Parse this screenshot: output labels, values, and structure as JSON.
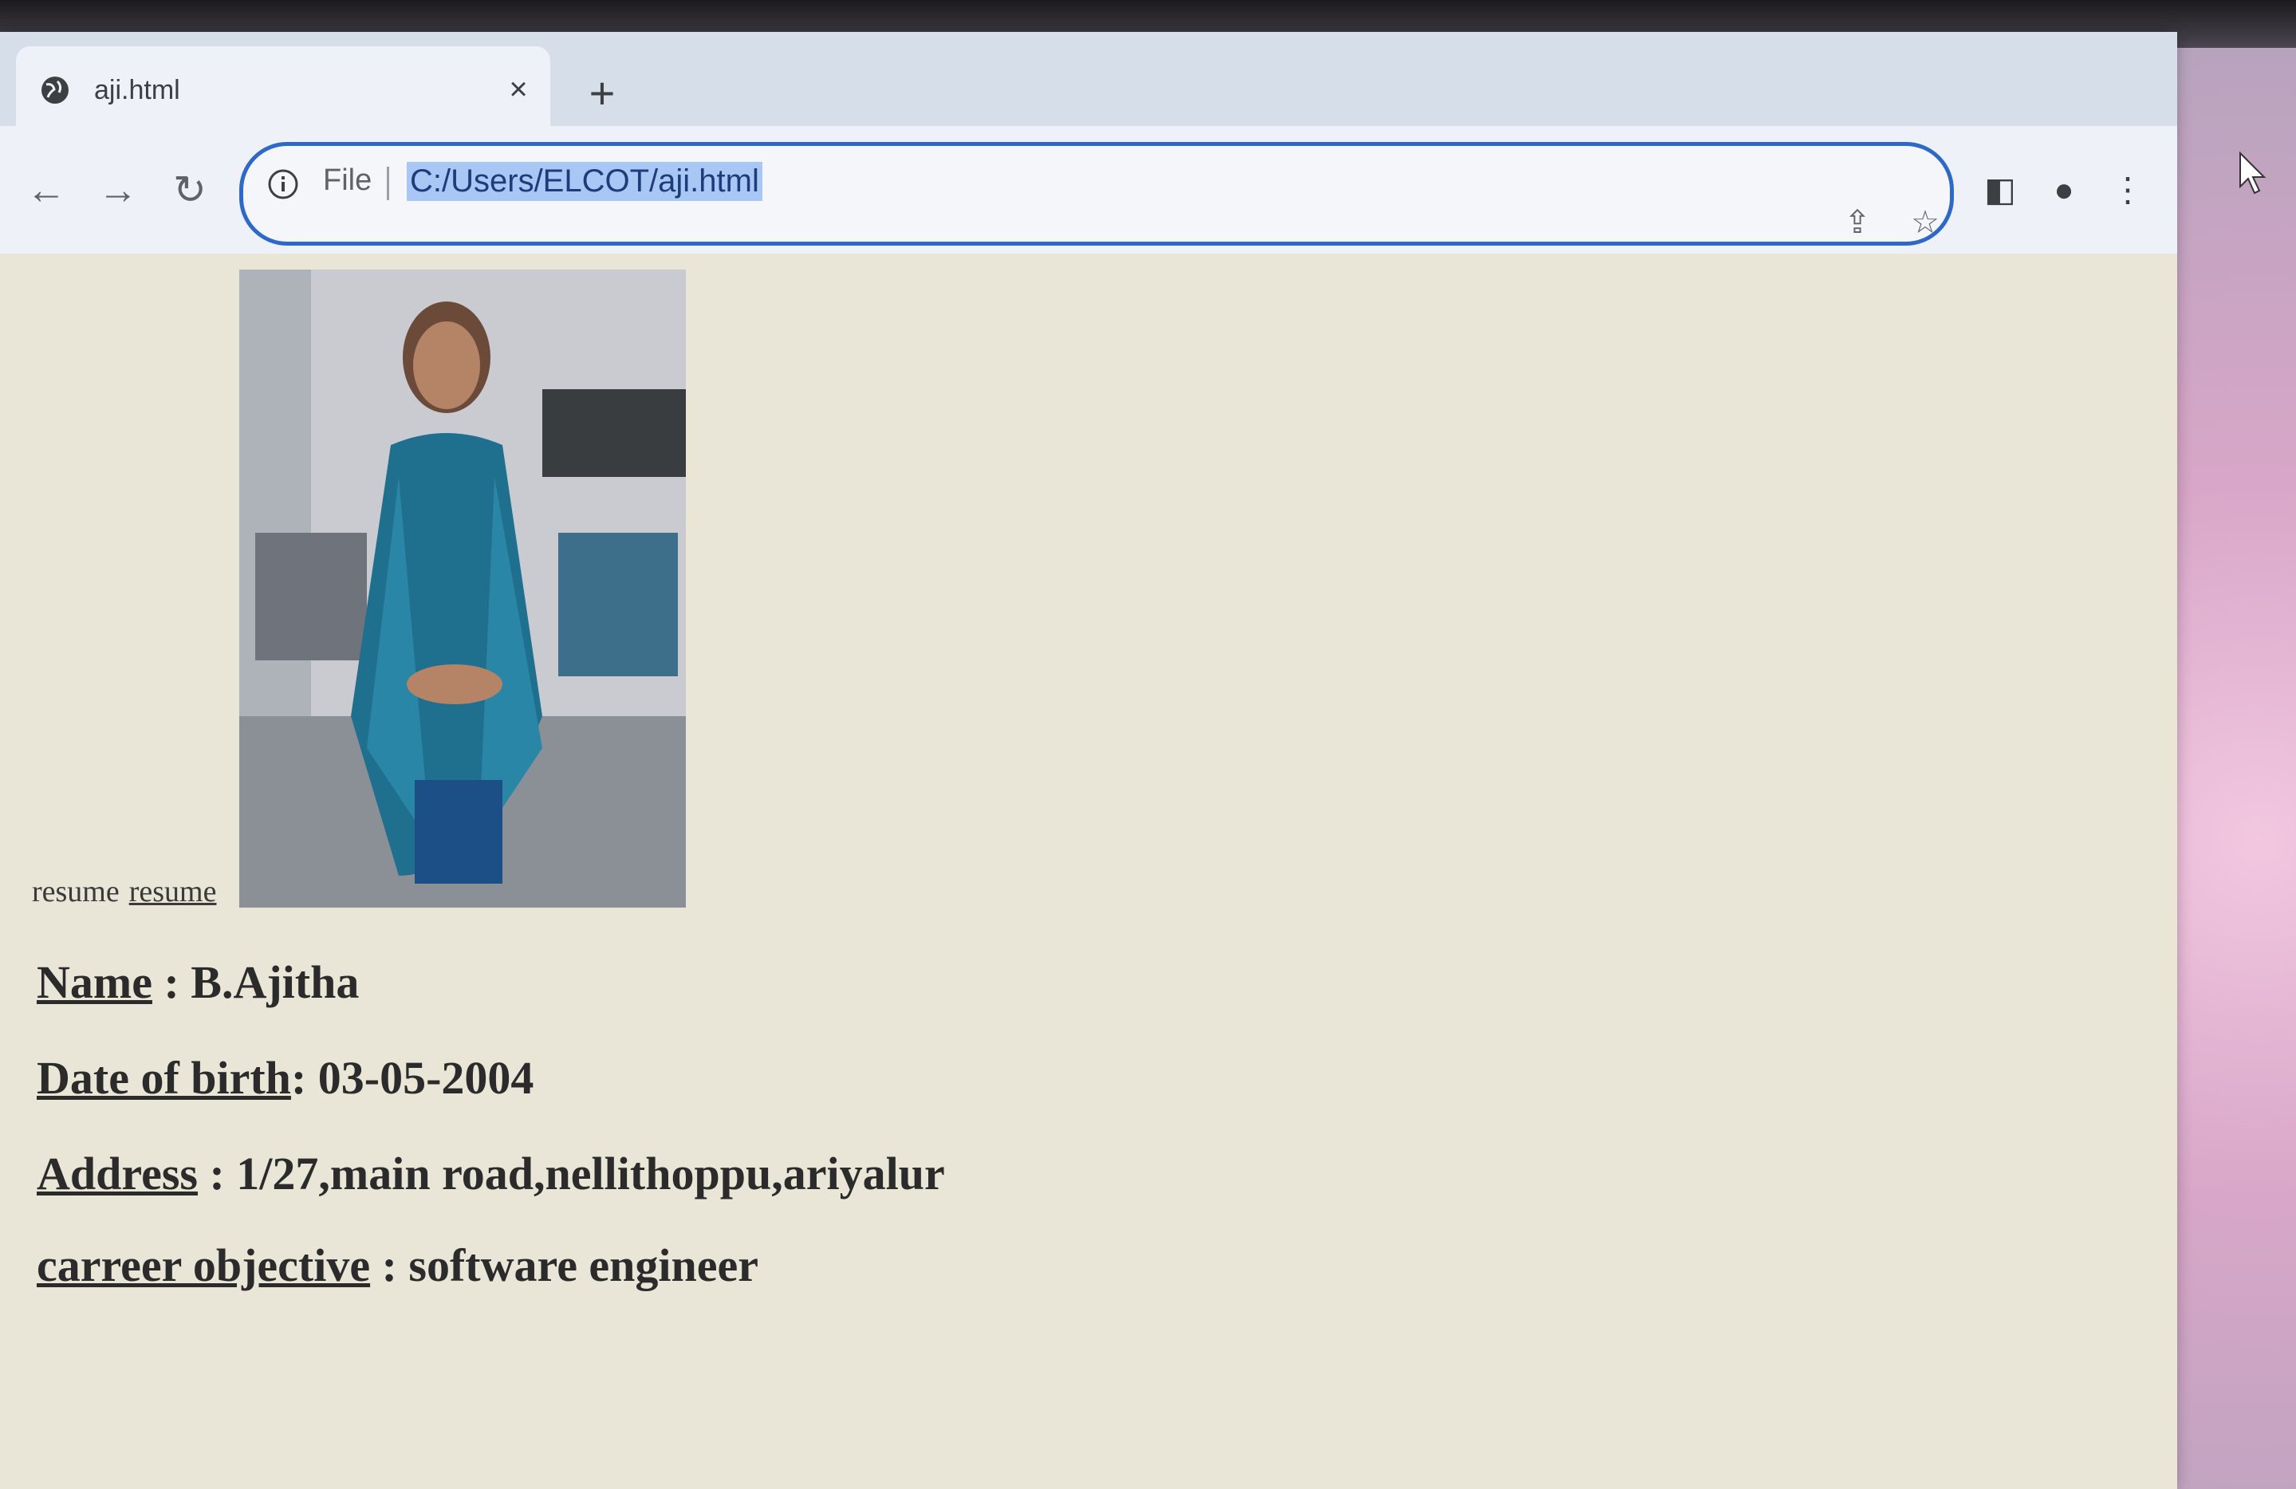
{
  "browser": {
    "tab_title": "aji.html",
    "tab_close": "×",
    "new_tab": "+",
    "scheme_label": "File",
    "url": "C:/Users/ELCOT/aji.html"
  },
  "page": {
    "resume_text": "resume",
    "resume_link": "resume",
    "name_label": "Name",
    "name_value": " : B.Ajitha",
    "dob_label": "Date of birth",
    "dob_value": ": 03-05-2004",
    "address_label": "Address",
    "address_value": " : 1/27,main road,nellithoppu,ariyalur",
    "objective_label": "carreer objective",
    "objective_value": " : software engineer"
  },
  "colors": {
    "page_background": "#e9e6d8",
    "url_highlight": "#a9c7f5",
    "omnibox_border": "#2d69c8",
    "dress": "#1f6f8f"
  }
}
